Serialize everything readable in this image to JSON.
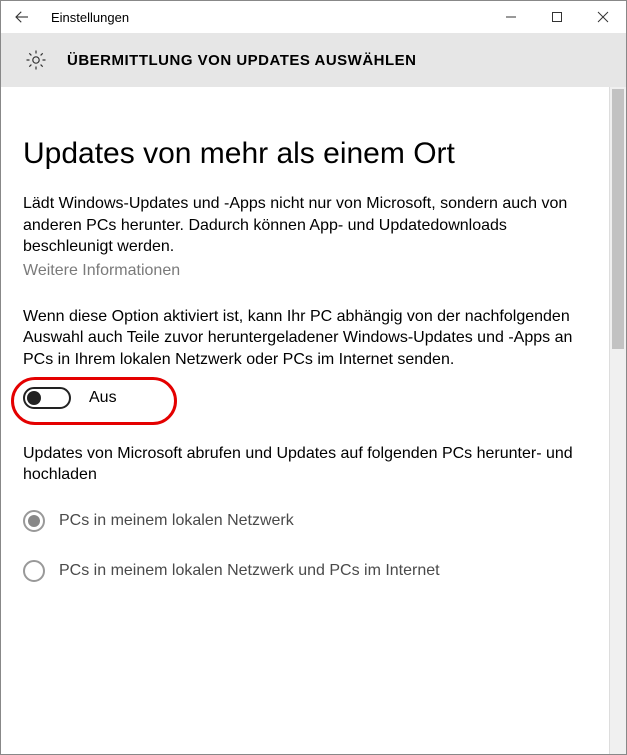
{
  "window": {
    "title": "Einstellungen"
  },
  "header": {
    "page_title": "ÜBERMITTLUNG VON UPDATES AUSWÄHLEN"
  },
  "main": {
    "heading": "Updates von mehr als einem Ort",
    "para1": "Lädt Windows-Updates und -Apps nicht nur von Microsoft, sondern auch von anderen PCs herunter. Dadurch können App- und Updatedownloads beschleunigt werden.",
    "learn_more": "Weitere Informationen",
    "para2": "Wenn diese Option aktiviert ist, kann Ihr PC abhängig von der nachfolgenden Auswahl auch Teile zuvor heruntergeladener Windows-Updates und -Apps an PCs in Ihrem lokalen Netzwerk oder PCs im Internet senden.",
    "toggle": {
      "state": "off",
      "label": "Aus"
    },
    "para3": "Updates von Microsoft abrufen und Updates auf folgenden PCs herunter- und hochladen",
    "radio_options": [
      {
        "label": "PCs in meinem lokalen Netzwerk",
        "selected": true
      },
      {
        "label": "PCs in meinem lokalen Netzwerk und PCs im Internet",
        "selected": false
      }
    ]
  }
}
